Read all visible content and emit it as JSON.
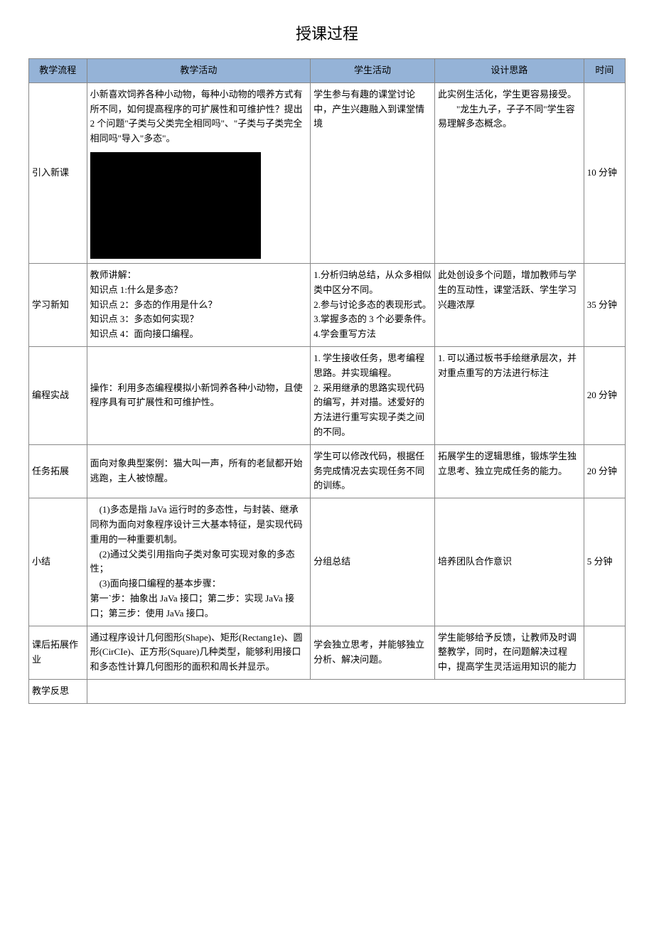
{
  "title": "授课过程",
  "header": {
    "col1": "教学流程",
    "col2": "教学活动",
    "col3": "学生活动",
    "col4": "设计思路",
    "col5": "时间"
  },
  "rows": [
    {
      "flow": "引入新课",
      "activity": "小新喜欢饲养各种小动物，每种小动物的喂养方式有所不同，如何提高程序的可扩展性和可维护性？提出 2 个问题\"子类与父类完全相同吗\"、\"子类与子类完全相同吗\"导入\"多态\"。",
      "blackbox": {
        "label_left": "",
        "label_center": ""
      },
      "student": "学生参与有趣的课堂讨论中，产生兴趣融入到课堂情境",
      "design": "此实例生活化，学生更容易接受。\n　　\"龙生九子，子子不同\"学生容易理解多态概念。",
      "time": "10 分钟"
    },
    {
      "flow": "学习新知",
      "activity": "教师讲解：\n知识点 1:什么是多态？\n知识点 2：多态的作用是什么？\n知识点 3：多态如何实现？\n知识点 4：面向接口编程。",
      "student": "1.分析归纳总结，从众多相似类中区分不同。\n2.参与讨论多态的表现形式。\n3.掌握多态的 3 个必要条件。\n4.学会重写方法",
      "design": "此处创设多个问题，增加教师与学生的互动性，课堂活跃、学生学习兴趣浓厚",
      "time": "35 分钟"
    },
    {
      "flow": "编程实战",
      "activity": "操作：利用多态编程模拟小新饲养各种小动物，且使程序具有可扩展性和可维护性。",
      "student": "1. 学生接收任务，思考编程思路。并实现编程。\n2. 采用继承的思路实现代码的编写，并对描。述爱好的方法进行重写实现子类之间的不同。",
      "design": "1. 可以通过板书手绘继承层次，并对重点重写的方法进行标注",
      "time": "20 分钟"
    },
    {
      "flow": "任务拓展",
      "activity": "面向对象典型案例：猫大叫一声，所有的老鼠都开始逃跑，主人被惊醒。",
      "student": "学生可以修改代码，根据任务完成情况去实现任务不同的训练。",
      "design": "拓展学生的逻辑思维，锻炼学生独立思考、独立完成任务的能力。",
      "time": "20 分钟"
    },
    {
      "flow": "小结",
      "activity": "　(1)多态是指 JaVa 运行时的多态性，与封装、继承同称为面向对象程序设计三大基本特征，是实现代码重用的一种重要机制。\n　(2)通过父类引用指向子类对象可实现对象的多态性；\n　(3)面向接口编程的基本步骤：\n第一`步：抽象出 JaVa 接口；第二步：实现 JaVa 接口；第三步：使用 JaVa 接口。",
      "student": "分组总结",
      "design": "培养团队合作意识",
      "time": "5 分钟"
    },
    {
      "flow": "课后拓展作业",
      "activity": "通过程序设计几何图形(Shape)、矩形(Rectang1e)、圆形(CirCIe)、正方形(Square)几种类型，能够利用接口和多态性计算几何图形的面积和周长并显示。",
      "student": "学会独立思考，并能够独立分析、解决问题。",
      "design": "学生能够给予反馈，让教师及时调整教学，同时，在问题解决过程中，提高学生灵活运用知识的能力",
      "time": ""
    },
    {
      "flow": "教学反思",
      "activity": "",
      "student": "",
      "design": "",
      "time": ""
    }
  ]
}
